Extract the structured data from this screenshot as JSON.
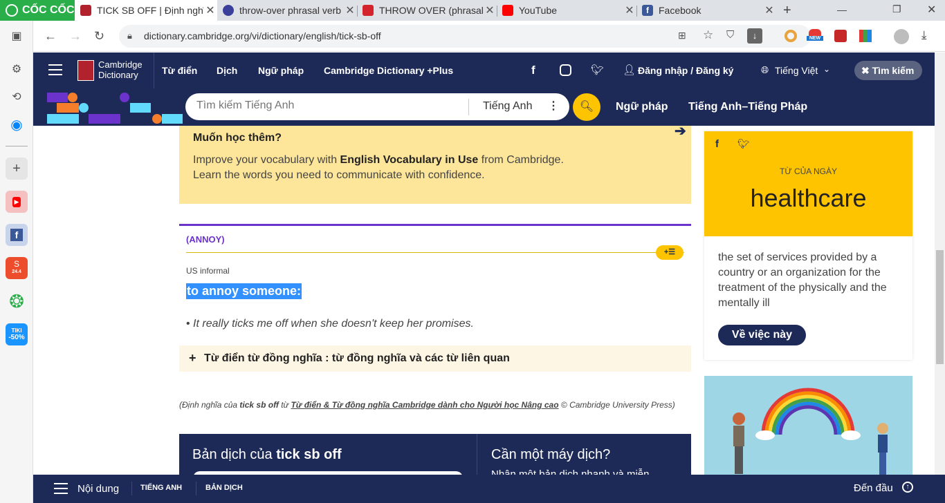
{
  "browser": {
    "brand": "CỐC CỐC",
    "tabs": [
      {
        "title": "TICK SB OFF | Định nghĩ",
        "active": true,
        "color": "#b1222c"
      },
      {
        "title": "throw-over phrasal verb",
        "active": false,
        "color": "#3a3f9b"
      },
      {
        "title": "THROW OVER (phrasal v",
        "active": false,
        "color": "#d4232a"
      },
      {
        "title": "YouTube",
        "active": false,
        "color": "#ff0000"
      },
      {
        "title": "Facebook",
        "active": false,
        "color": "#3b5998"
      }
    ],
    "url": "dictionary.cambridge.org/vi/dictionary/english/tick-sb-off",
    "new_badge": "NEW"
  },
  "sidebar": {
    "shopee_badge": "24.4",
    "tiki_label": "TIKI",
    "tiki_discount": "-50%"
  },
  "site": {
    "logo_line1": "Cambridge",
    "logo_line2": "Dictionary",
    "nav": [
      "Từ điển",
      "Dịch",
      "Ngữ pháp",
      "Cambridge Dictionary +Plus"
    ],
    "login": "Đăng nhập / Đăng ký",
    "language": "Tiếng Việt",
    "search_toggle": "Tìm kiếm",
    "search_placeholder": "Tìm kiếm Tiếng Anh",
    "search_lang": "Tiếng Anh",
    "sub_nav": [
      "Ngữ pháp",
      "Tiếng Anh–Tiếng Pháp"
    ]
  },
  "promo": {
    "title": "Muốn học thêm?",
    "line1_pre": "Improve your vocabulary with ",
    "line1_bold": "English Vocabulary in Use",
    "line1_post": " from Cambridge.",
    "line2": "Learn the words you need to communicate with confidence."
  },
  "entry": {
    "guide_word": "(ANNOY)",
    "labels": "US informal",
    "definition": "to annoy someone:",
    "example": "It really ticks me off when she doesn't keep her promises.",
    "thesaurus": "Từ điển từ đồng nghĩa : từ đồng nghĩa và các từ liên quan",
    "source_pre": "(Định nghĩa của ",
    "source_word": "tick sb off",
    "source_mid": " từ ",
    "source_link": "Từ điển & Từ đồng nghĩa Cambridge dành cho Người học Nâng cao",
    "source_post": " © Cambridge University Press)"
  },
  "translate": {
    "title_pre": "Bản dịch của ",
    "title_bold": "tick sb off",
    "machine_title": "Cần một máy dịch?",
    "machine_text": "Nhận một bản dịch nhanh và miễn"
  },
  "wotd": {
    "label": "TỪ CỦA NGÀY",
    "word": "healthcare",
    "definition": "the set of services provided by a country or an organization for the treatment of the physically and the mentally ill",
    "button": "Về việc này"
  },
  "bottom": {
    "menu": "Nội dung",
    "tab1": "TIẾNG ANH",
    "tab2": "BẢN DỊCH",
    "top": "Đến đầu"
  }
}
